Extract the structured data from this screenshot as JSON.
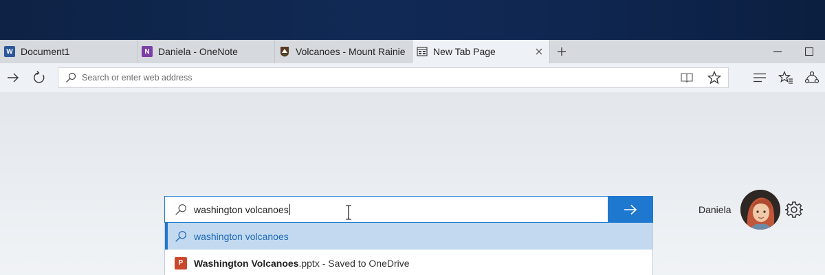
{
  "tabs": [
    {
      "title": "Document1",
      "icon": "word-icon",
      "icon_color": "#2b579a",
      "icon_letter": "W"
    },
    {
      "title": "Daniela - OneNote",
      "icon": "onenote-icon",
      "icon_color": "#7b3fa5",
      "icon_letter": "N"
    },
    {
      "title": "Volcanoes - Mount Rainie",
      "icon": "park-service-icon",
      "icon_color": "#5a3a22",
      "icon_letter": ""
    },
    {
      "title": "New Tab Page",
      "icon": "new-tab-page-icon",
      "active": true
    }
  ],
  "toolbar": {
    "address_placeholder": "Search or enter web address"
  },
  "search": {
    "query": "washington volcanoes",
    "accent_color": "#1e78d0"
  },
  "suggestions": [
    {
      "type": "search",
      "text": "washington volcanoes"
    },
    {
      "type": "file",
      "icon": "powerpoint-icon",
      "bold": "Washington Volcanoes",
      "rest": ".pptx - Saved to OneDrive"
    }
  ],
  "profile": {
    "name": "Daniela"
  }
}
